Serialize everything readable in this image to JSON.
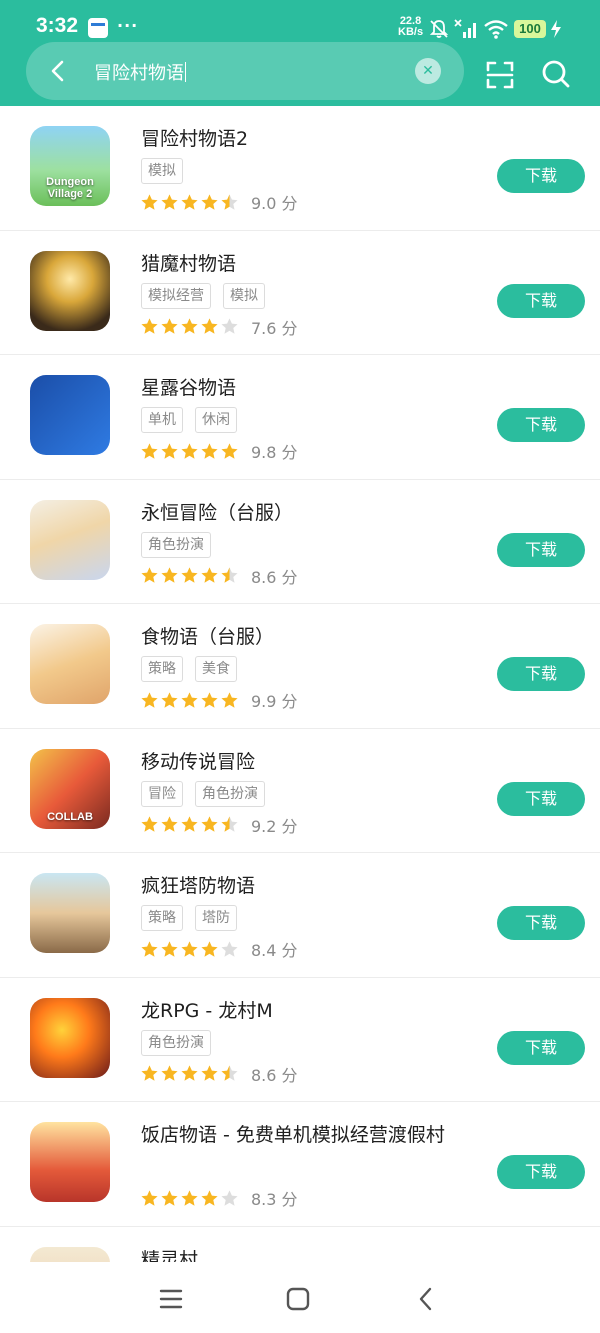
{
  "status_bar": {
    "time": "3:32",
    "dots": "···",
    "net_speed_value": "22.8",
    "net_speed_unit": "KB/s",
    "battery": "100"
  },
  "search": {
    "query": "冒险村物语",
    "clear_icon": "close-icon",
    "back_icon": "back-arrow-icon",
    "scan_icon": "scan-icon",
    "search_icon": "search-icon"
  },
  "colors": {
    "accent": "#2bbd9e",
    "star_filled": "#f8b621",
    "star_empty": "#dddddd",
    "tag_text": "#8a8a8a"
  },
  "download_label": "下载",
  "apps": [
    {
      "name": "冒险村物语2",
      "tags": [
        "模拟"
      ],
      "stars": 4.5,
      "score": "9.0 分",
      "icon_text": "Dungeon Village 2"
    },
    {
      "name": "猎魔村物语",
      "tags": [
        "模拟经营",
        "模拟"
      ],
      "stars": 4,
      "score": "7.6 分"
    },
    {
      "name": "星露谷物语",
      "tags": [
        "单机",
        "休闲"
      ],
      "stars": 5,
      "score": "9.8 分"
    },
    {
      "name": "永恒冒险（台服）",
      "tags": [
        "角色扮演"
      ],
      "stars": 4.5,
      "score": "8.6 分"
    },
    {
      "name": "食物语（台服）",
      "tags": [
        "策略",
        "美食"
      ],
      "stars": 5,
      "score": "9.9 分"
    },
    {
      "name": "移动传说冒险",
      "tags": [
        "冒险",
        "角色扮演"
      ],
      "stars": 4.5,
      "score": "9.2 分",
      "icon_text": "COLLAB"
    },
    {
      "name": "疯狂塔防物语",
      "tags": [
        "策略",
        "塔防"
      ],
      "stars": 4,
      "score": "8.4 分"
    },
    {
      "name": "龙RPG - 龙村M",
      "tags": [
        "角色扮演"
      ],
      "stars": 4.5,
      "score": "8.6 分"
    },
    {
      "name": "饭店物语 - 免费单机模拟经营渡假村",
      "tags": [],
      "stars": 4,
      "score": "8.3 分"
    },
    {
      "name": "精灵村",
      "tags": [],
      "stars": 0,
      "score": ""
    }
  ],
  "nav_bar": {
    "menu_icon": "menu-icon",
    "home_icon": "home-icon",
    "back_icon": "back-icon"
  }
}
